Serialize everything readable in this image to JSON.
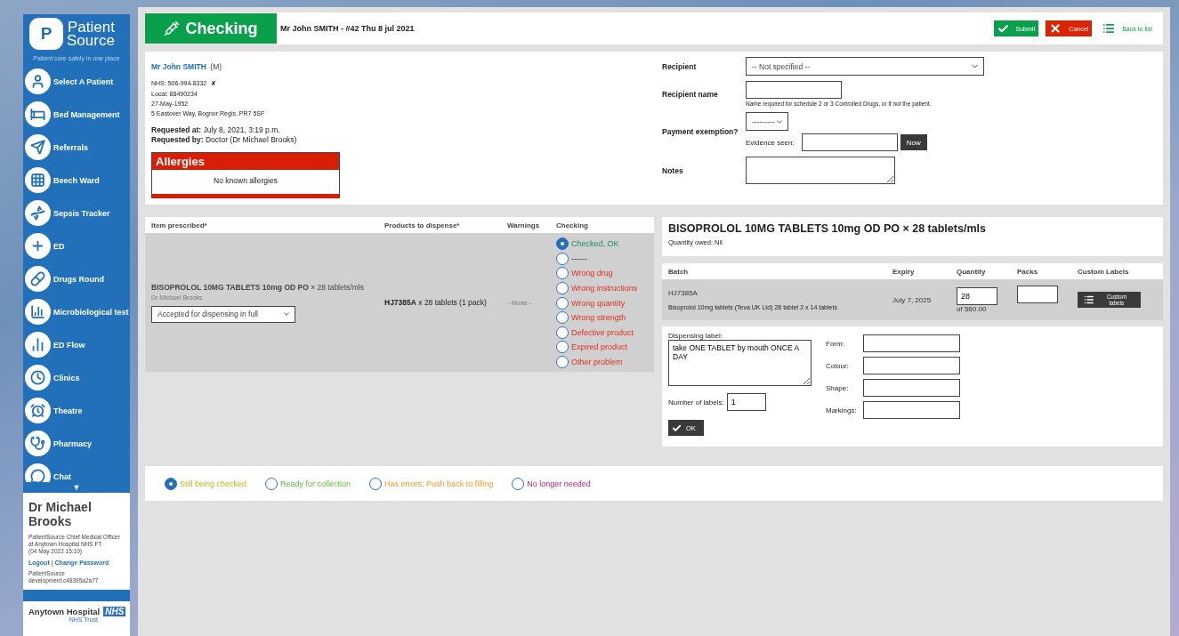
{
  "sidebar": {
    "logo": {
      "letter": "P",
      "name_top": "Patient",
      "name_bottom": "Source",
      "tagline": "Patient care safely in one place"
    },
    "items": [
      {
        "label": "Select A Patient"
      },
      {
        "label": "Bed Management"
      },
      {
        "label": "Referrals"
      },
      {
        "label": "Beech Ward"
      },
      {
        "label": "Sepsis Tracker"
      },
      {
        "label": "ED"
      },
      {
        "label": "Drugs Round"
      },
      {
        "label": "Microbiological test"
      },
      {
        "label": "ED Flow"
      },
      {
        "label": "Clinics"
      },
      {
        "label": "Theatre"
      },
      {
        "label": "Pharmacy"
      },
      {
        "label": "Chat"
      }
    ],
    "more_arrow": "▼",
    "user": {
      "name": "Dr Michael Brooks",
      "role": "PatientSource Chief Medical Officer at Anytown Hospital NHS FT",
      "login_time": "(04 May 2022 15:10)",
      "links": [
        "Logout",
        "Change Password"
      ],
      "separator": "|",
      "build": "PatientSource development.c48395a2a77"
    },
    "footer": {
      "hospital": "Anytown Hospital",
      "badge": "NHS",
      "trust": "NHS Trust"
    }
  },
  "header": {
    "title": "Checking",
    "subtitle": "Mr John SMITH - #42 Thu 8 jul 2021",
    "buttons": [
      {
        "label": "Submit",
        "kind": "submit"
      },
      {
        "label": "Cancel",
        "kind": "cancel"
      },
      {
        "label": "Back to list",
        "kind": "link"
      }
    ]
  },
  "patient": {
    "name": "Mr John SMITH",
    "sex": "(M)",
    "nhs": "NHS: 506-994-8332",
    "nhs_flag": "✘",
    "local": "Local: 88490234",
    "dob": "27-May-1952",
    "address": "5 Eastover Way, Bognor Regis, PR7 5SF",
    "requested_at": "**Requested at:** July 8, 2021, 3:19 p.m.",
    "requested_by": "**Requested by:** Doctor (Dr Michael Brooks)"
  },
  "allergies": {
    "title": "Allergies",
    "text": "No known allergies"
  },
  "collection_form": {
    "recipient": {
      "label": "Recipient",
      "value": "-- Not specified --"
    },
    "recipient_name": {
      "label": "Recipient name",
      "hint": "Name required for schedule 2 or 3 Controlled Drugs, or if not the patient."
    },
    "payment_exemption": {
      "label": "Payment exemption?",
      "value": "---------",
      "evidence_label": "Evidence seen:",
      "now_button": "Now"
    },
    "notes": {
      "label": "Notes"
    }
  },
  "prescription_table": {
    "columns": [
      "Item prescribed*",
      "Products to dispense*",
      "Warnings",
      "Checking"
    ],
    "row": {
      "item": "**BISOPROLOL 10MG TABLETS 10mg OD PO** × 28 tablets/mls",
      "prescriber": "Dr Michael Brooks",
      "decision": "Accepted for dispensing in full",
      "product": "**HJ7385A** x 28 tablets (1 pack)",
      "warnings": "- None -",
      "checking_options": [
        {
          "label": "Checked, OK",
          "selected": true,
          "kind": "ok"
        },
        {
          "label": "------",
          "selected": false,
          "kind": "blank"
        },
        {
          "label": "Wrong drug",
          "selected": false,
          "kind": "problem"
        },
        {
          "label": "Wrong instructions",
          "selected": false,
          "kind": "problem"
        },
        {
          "label": "Wrong quantity",
          "selected": false,
          "kind": "problem"
        },
        {
          "label": "Wrong strength",
          "selected": false,
          "kind": "problem"
        },
        {
          "label": "Defective product",
          "selected": false,
          "kind": "problem"
        },
        {
          "label": "Expired product",
          "selected": false,
          "kind": "problem"
        },
        {
          "label": "Other problem",
          "selected": false,
          "kind": "problem"
        }
      ]
    }
  },
  "product": {
    "title": "BISOPROLOL 10MG TABLETS 10mg OD PO × 28 tablets/mls",
    "owed": "Quantity owed: Nil"
  },
  "batch_table": {
    "columns": [
      "Batch",
      "Expiry",
      "Quantity",
      "Packs",
      "Custom Labels"
    ],
    "row": {
      "batch": "HJ7385A",
      "description": "Bisoprolol 10mg tablets (Teva UK Ltd) 28 tablet 2 x 14 tablets",
      "expiry": "July 7, 2025",
      "quantity": "28",
      "quantity_of": "of 560.00",
      "button": "Custom labels"
    }
  },
  "dispensing": {
    "label": "Dispensing label:",
    "text": "take ONE TABLET by mouth ONCE A DAY",
    "labels_count_label": "Number of labels:",
    "labels_count": "1",
    "ok_button": "OK",
    "fields": [
      "Form:",
      "Colour:",
      "Shape:",
      "Markings:"
    ]
  },
  "status_options": [
    {
      "label": "Still being checked",
      "selected": true,
      "kind": "checking"
    },
    {
      "label": "Ready for collection",
      "selected": false,
      "kind": "ready"
    },
    {
      "label": "Has errors: Push back to filling",
      "selected": false,
      "kind": "errors"
    },
    {
      "label": "No longer needed",
      "selected": false,
      "kind": "cancelled"
    }
  ]
}
